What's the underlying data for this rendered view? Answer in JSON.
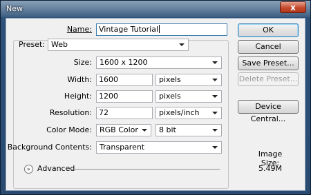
{
  "window": {
    "title": "New",
    "close_glyph": "x"
  },
  "form": {
    "name_label": "Name:",
    "name_value": "Vintage Tutorial",
    "preset_label": "Preset:",
    "preset_value": "Web",
    "size_label": "Size:",
    "size_value": "1600 x 1200",
    "width_label": "Width:",
    "width_value": "1600",
    "width_unit": "pixels",
    "height_label": "Height:",
    "height_value": "1200",
    "height_unit": "pixels",
    "resolution_label": "Resolution:",
    "resolution_value": "72",
    "resolution_unit": "pixels/inch",
    "color_mode_label": "Color Mode:",
    "color_mode_value": "RGB Color",
    "bit_depth_value": "8 bit",
    "background_label": "Background Contents:",
    "background_value": "Transparent",
    "advanced_label": "Advanced"
  },
  "buttons": {
    "ok": "OK",
    "cancel": "Cancel",
    "save_preset": "Save Preset...",
    "delete_preset": "Delete Preset...",
    "device_central": "Device Central..."
  },
  "image_size": {
    "label": "Image Size:",
    "value": "5.49M"
  },
  "icons": {
    "advanced_toggle": "chevron-down-double-icon",
    "close": "close-icon",
    "dropdown": "chevron-down-icon"
  }
}
